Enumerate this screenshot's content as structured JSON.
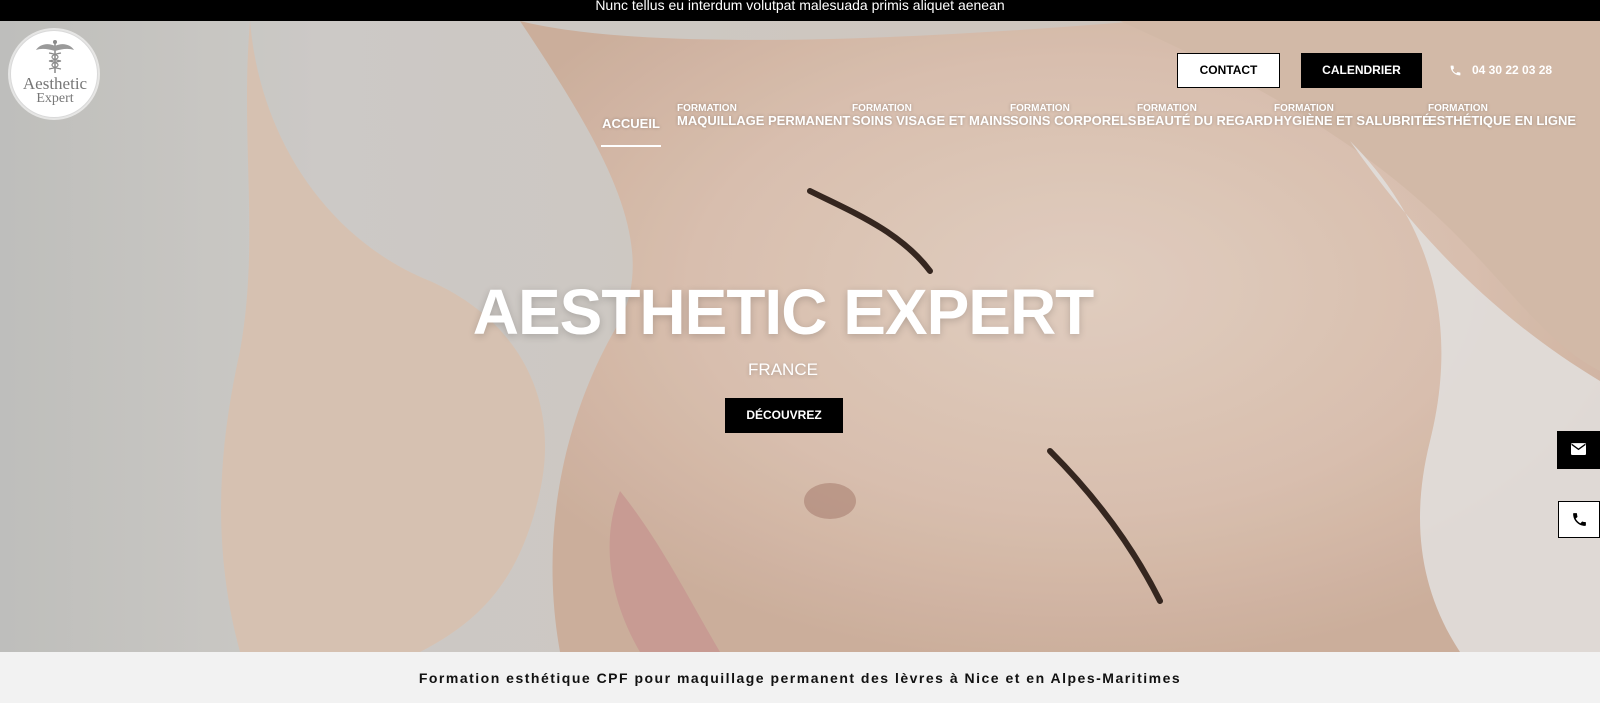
{
  "announcement": "Nunc tellus eu interdum volutpat malesuada primis aliquet aenean",
  "logo": {
    "line1": "Aesthetic",
    "line2": "Expert"
  },
  "header": {
    "contact_label": "CONTACT",
    "calendar_label": "CALENDRIER",
    "phone_number": "04 30 22 03 28"
  },
  "nav": {
    "home": "ACCUEIL",
    "items": [
      {
        "small": "FORMATION",
        "label": "MAQUILLAGE PERMANENT"
      },
      {
        "small": "FORMATION",
        "label": "SOINS VISAGE ET MAINS"
      },
      {
        "small": "FORMATION",
        "label": "SOINS CORPORELS"
      },
      {
        "small": "FORMATION",
        "label": "BEAUTÉ DU REGARD"
      },
      {
        "small": "FORMATION",
        "label": "HYGIÈNE ET SALUBRITÉ"
      },
      {
        "small": "FORMATION",
        "label": "ESTHÉTIQUE EN LIGNE"
      }
    ]
  },
  "hero": {
    "title": "AESTHETIC EXPERT",
    "subtitle": "FRANCE",
    "cta_label": "DÉCOUVREZ"
  },
  "footer": {
    "tagline": "Formation esthétique CPF pour maquillage permanent des lèvres à Nice et en Alpes-Maritimes"
  },
  "icons": {
    "phone": "phone-icon",
    "mail": "mail-icon",
    "logo_symbol": "caduceus-icon"
  },
  "colors": {
    "topbar": "#000000",
    "button_dark": "#000000",
    "button_light": "#ffffff",
    "footer_band": "#f2f2f2"
  }
}
